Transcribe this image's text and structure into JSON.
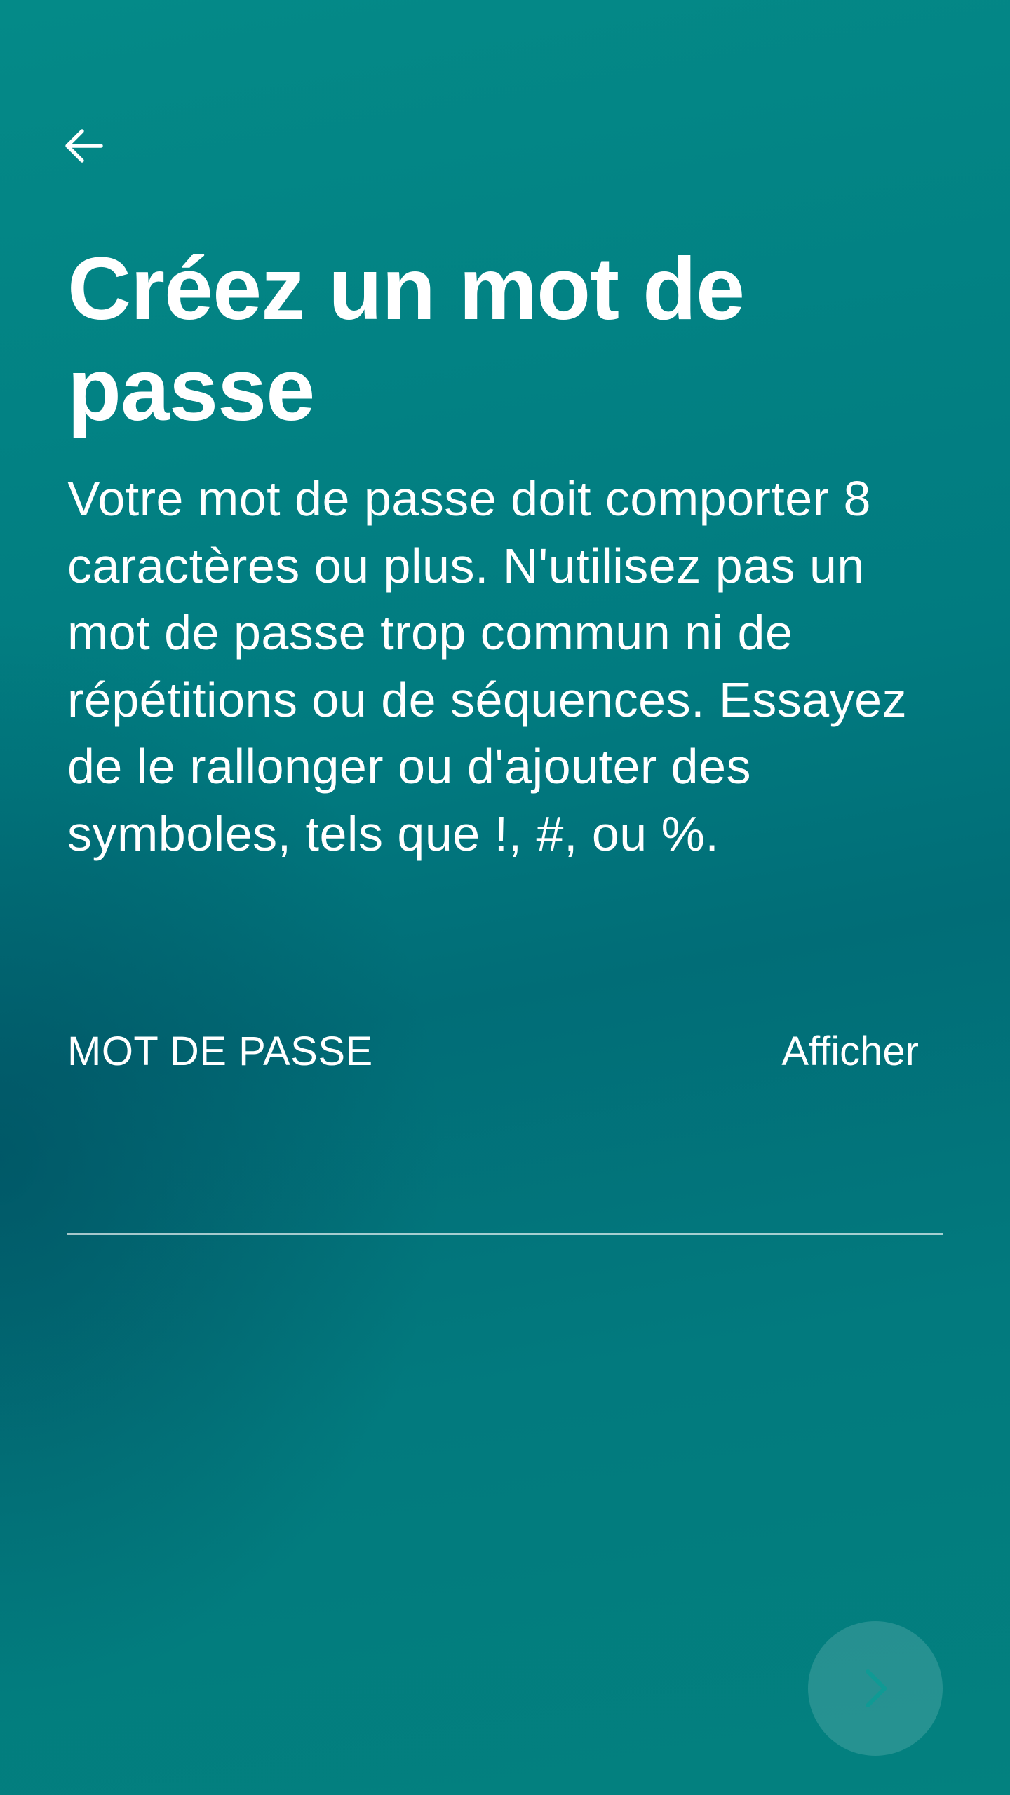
{
  "header": {
    "back_icon": "arrow-left-icon"
  },
  "content": {
    "title": "Créez un mot de passe",
    "description": "Votre mot de passe doit comporter 8 caractères ou plus. N'utilisez pas un mot de passe trop commun ni de répétitions ou de séquences. Essayez de le rallonger ou d'ajouter des symboles, tels que !, #, ou %."
  },
  "password_field": {
    "label": "MOT DE PASSE",
    "toggle_label": "Afficher",
    "value": ""
  },
  "footer": {
    "next_icon": "chevron-right-icon"
  },
  "colors": {
    "background": "#017b80",
    "text": "#ffffff",
    "next_chevron": "#0f9a94"
  }
}
